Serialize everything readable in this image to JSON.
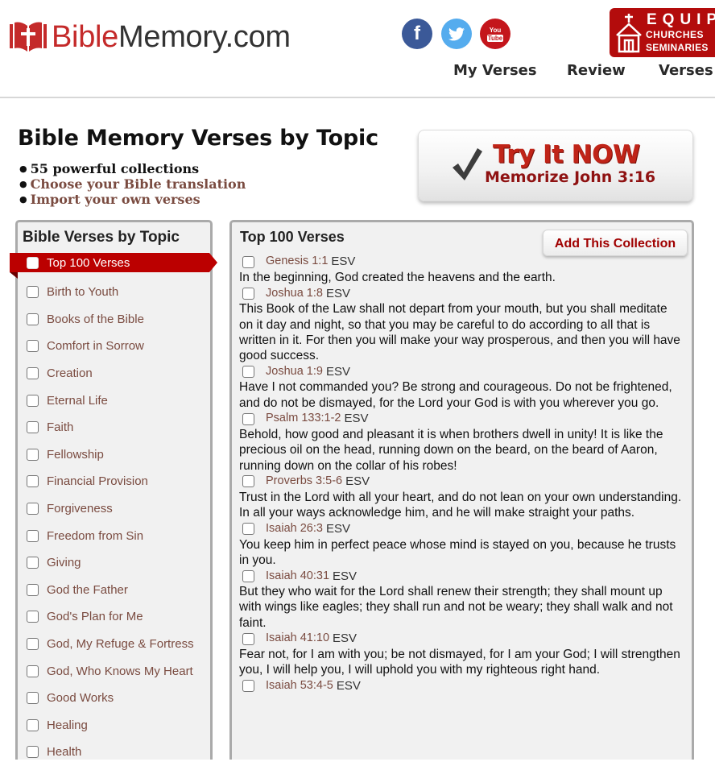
{
  "header": {
    "logo": {
      "part1": "Bible",
      "part2": "Memory.com"
    },
    "social": [
      {
        "name": "facebook",
        "icon": "facebook-icon",
        "glyph": "f",
        "color": "#3b5998"
      },
      {
        "name": "twitter",
        "icon": "twitter-icon",
        "color": "#55acee"
      },
      {
        "name": "youtube",
        "icon": "youtube-icon",
        "line1": "You",
        "line2": "Tube",
        "color": "#c4161c"
      }
    ],
    "equip_banner": {
      "line1": "EQUIP",
      "line2": "CHURCHES",
      "line3": "SEMINARIES",
      "color": "#b30c0c"
    },
    "nav": [
      {
        "label": "My Verses"
      },
      {
        "label": "Review"
      },
      {
        "label": "Verses I"
      }
    ]
  },
  "intro": {
    "title": "Bible Memory Verses by Topic",
    "bullets": [
      {
        "text": "55 powerful collections"
      },
      {
        "text": "Choose your Bible translation"
      },
      {
        "text": "Import your own verses"
      }
    ],
    "try_button": {
      "line1": "Try It NOW",
      "line2": "Memorize John 3:16"
    }
  },
  "sidebar": {
    "title": "Bible Verses by Topic",
    "accent": "#bb0000",
    "items": [
      {
        "label": "Top 100 Verses",
        "active": true
      },
      {
        "label": "Birth to Youth"
      },
      {
        "label": "Books of the Bible"
      },
      {
        "label": "Comfort in Sorrow"
      },
      {
        "label": "Creation"
      },
      {
        "label": "Eternal Life"
      },
      {
        "label": "Faith"
      },
      {
        "label": "Fellowship"
      },
      {
        "label": "Financial Provision"
      },
      {
        "label": "Forgiveness"
      },
      {
        "label": "Freedom from Sin"
      },
      {
        "label": "Giving"
      },
      {
        "label": "God the Father"
      },
      {
        "label": "God's Plan for Me"
      },
      {
        "label": "God, My Refuge & Fortress"
      },
      {
        "label": "God, Who Knows My Heart"
      },
      {
        "label": "Good Works"
      },
      {
        "label": "Healing"
      },
      {
        "label": "Health"
      }
    ]
  },
  "collection": {
    "title": "Top 100 Verses",
    "add_button": "Add This Collection",
    "verses": [
      {
        "ref": "Genesis 1:1",
        "version": "ESV",
        "text": "In the beginning, God created the heavens and the earth."
      },
      {
        "ref": "Joshua 1:8",
        "version": "ESV",
        "text": "This Book of the Law shall not depart from your mouth, but you shall meditate on it day and night, so that you may be careful to do according to all that is written in it. For then you will make your way prosperous, and then you will have good success."
      },
      {
        "ref": "Joshua 1:9",
        "version": "ESV",
        "text": "Have I not commanded you? Be strong and courageous. Do not be frightened, and do not be dismayed, for the Lord your God is with you wherever you go."
      },
      {
        "ref": "Psalm 133:1-2",
        "version": "ESV",
        "text": "Behold, how good and pleasant it is when brothers dwell in unity! It is like the precious oil on the head, running down on the beard, on the beard of Aaron, running down on the collar of his robes!"
      },
      {
        "ref": "Proverbs 3:5-6",
        "version": "ESV",
        "text": "Trust in the Lord with all your heart, and do not lean on your own understanding. In all your ways acknowledge him, and he will make straight your paths."
      },
      {
        "ref": "Isaiah 26:3",
        "version": "ESV",
        "text": "You keep him in perfect peace whose mind is stayed on you, because he trusts in you."
      },
      {
        "ref": "Isaiah 40:31",
        "version": "ESV",
        "text": "But they who wait for the Lord shall renew their strength; they shall mount up with wings like eagles; they shall run and not be weary; they shall walk and not faint."
      },
      {
        "ref": "Isaiah 41:10",
        "version": "ESV",
        "text": "Fear not, for I am with you; be not dismayed, for I am your God; I will strengthen you, I will help you, I will uphold you with my righteous right hand."
      },
      {
        "ref": "Isaiah 53:4-5",
        "version": "ESV",
        "text": ""
      }
    ]
  }
}
